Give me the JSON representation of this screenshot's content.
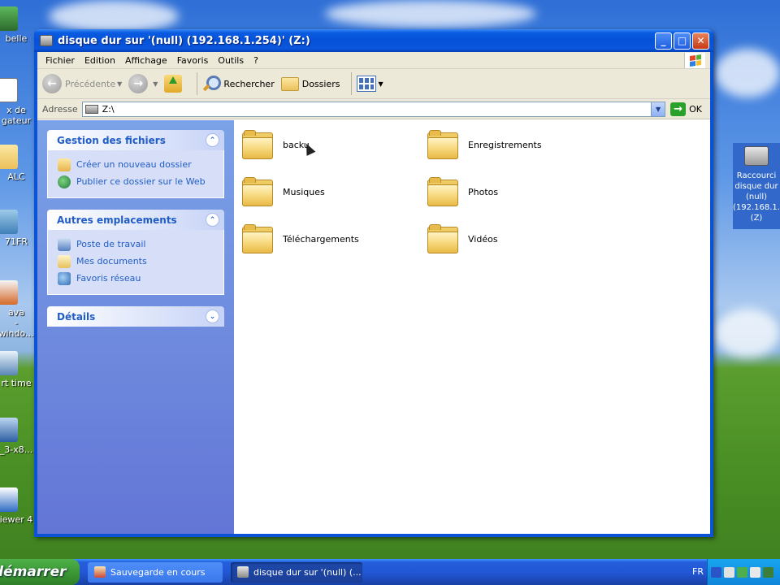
{
  "desktop": {
    "left_icons": [
      "belle",
      "x de\ngateur",
      "ALC",
      "71FR",
      "ava\n-windo...",
      "rt time",
      "_3-x8...",
      "iewer 4"
    ],
    "right_icon": {
      "label": "Raccourci disque dur (null) (192.168.1... (Z)"
    }
  },
  "window": {
    "title": "disque dur sur '(null) (192.168.1.254)' (Z:)",
    "controls": {
      "minimize": "_",
      "maximize": "□",
      "close": "✕"
    }
  },
  "menu": [
    "Fichier",
    "Edition",
    "Affichage",
    "Favoris",
    "Outils",
    "?"
  ],
  "toolbar": {
    "back": "Précédente",
    "search": "Rechercher",
    "folders": "Dossiers"
  },
  "address": {
    "label": "Adresse",
    "value": "Z:\\",
    "go": "OK"
  },
  "taskpane": {
    "file_tasks": {
      "title": "Gestion des fichiers",
      "items": [
        "Créer un nouveau dossier",
        "Publier ce dossier sur le Web"
      ]
    },
    "other_places": {
      "title": "Autres emplacements",
      "items": [
        "Poste de travail",
        "Mes documents",
        "Favoris réseau"
      ]
    },
    "details": {
      "title": "Détails"
    }
  },
  "folders": [
    "backu",
    "Enregistrements",
    "Musiques",
    "Photos",
    "Téléchargements",
    "Vidéos"
  ],
  "taskbar": {
    "start": "démarrer",
    "tasks": [
      "Sauvegarde en cours",
      "disque dur sur '(null) (..."
    ],
    "lang": "FR"
  },
  "colors": {
    "title_blue": "#0551d8",
    "link_blue": "#215dc6",
    "start_green": "#3c9a35"
  }
}
